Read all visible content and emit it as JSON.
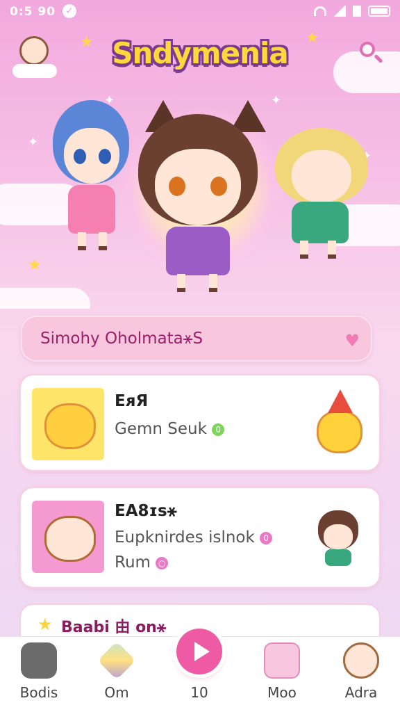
{
  "status_bar": {
    "time": "0:5 90"
  },
  "header": {
    "app_title": "Sndymenia"
  },
  "banner": {
    "text": "Simohy Oholmata⚹S"
  },
  "cards": [
    {
      "title": "EᴙЯ",
      "subtitle": "Gemn Seuk",
      "badge": "0"
    },
    {
      "title": "EA8ɪs⚹",
      "subtitle": "Eupknirdes islnok",
      "badge": "0",
      "extra": "Rum"
    }
  ],
  "partial_card": {
    "label": "Baabi 由 on⚹"
  },
  "nav": {
    "items": [
      {
        "label": "Bodis"
      },
      {
        "label": "Om"
      },
      {
        "label": "10"
      },
      {
        "label": "Moo"
      },
      {
        "label": "Adra"
      }
    ]
  },
  "colors": {
    "accent": "#ee5aa3",
    "banner_text": "#9b1f6a",
    "logo_fill": "#ffd93b",
    "logo_outline": "#7a3b8f"
  }
}
